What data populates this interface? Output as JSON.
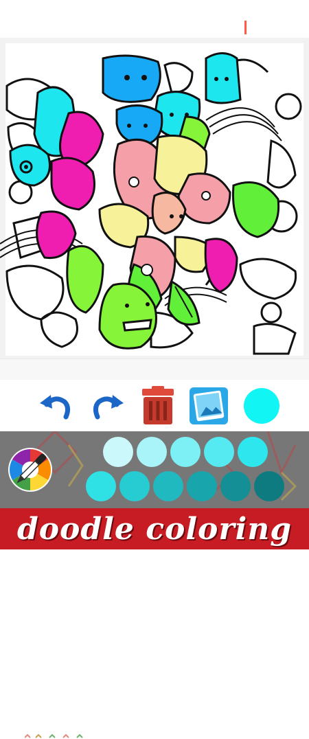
{
  "app": {
    "banner_title": "doodle coloring"
  },
  "canvas": {
    "fills": {
      "blue": "#17a9f5",
      "cyan": "#1de6ef",
      "magenta": "#f01eb0",
      "pink": "#f5a0a8",
      "yellow": "#f7f29a",
      "green": "#86f53a",
      "lime": "#62ef3a",
      "peach": "#f6b8a0"
    }
  },
  "toolbar": {
    "undo_icon": "undo-arrow-icon",
    "redo_icon": "redo-arrow-icon",
    "delete_icon": "trash-icon",
    "gallery_icon": "gallery-icon",
    "current_color": "#12f5f5"
  },
  "palette": {
    "picker_icon": "color-wheel-dropper-icon",
    "row1": [
      "#cbf9fb",
      "#a9f4f8",
      "#7cf0f5",
      "#55eaf1",
      "#2ee6ee"
    ],
    "row2": [
      "#2fe0e4",
      "#27ccd2",
      "#1fb9bf",
      "#18a5ab",
      "#138f95",
      "#0e7b80"
    ]
  }
}
